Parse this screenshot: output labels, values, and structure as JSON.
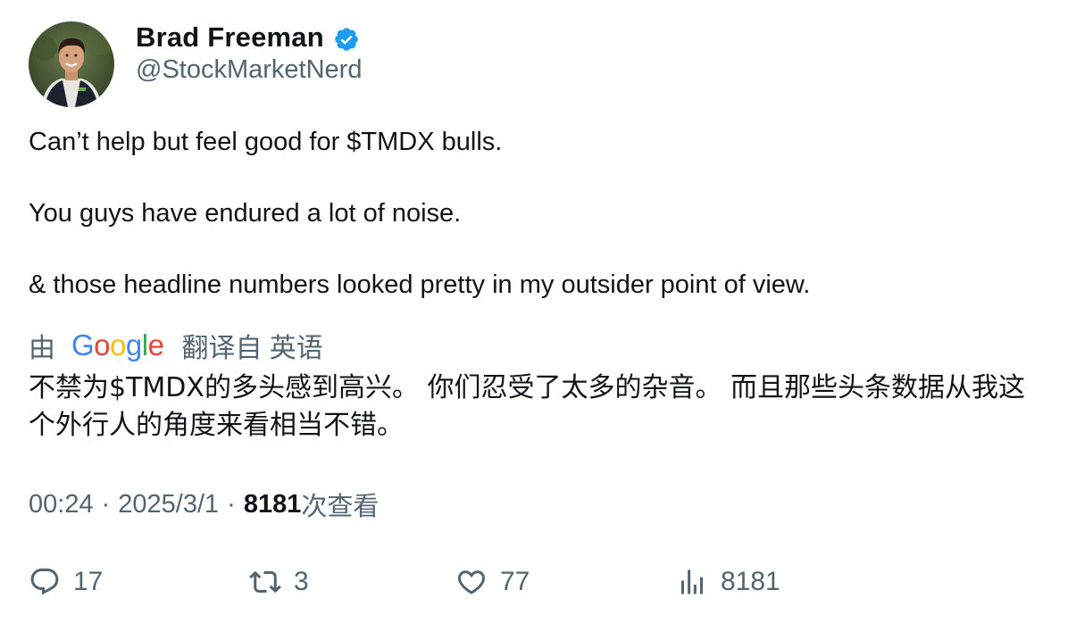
{
  "author": {
    "display_name": "Brad Freeman",
    "handle": "@StockMarketNerd",
    "verified_icon": "verified-badge-icon",
    "verified_color": "#1d9bf0"
  },
  "tweet": {
    "lines": [
      "Can’t help but feel good for $TMDX bulls.",
      "You guys have endured a lot of noise.",
      "& those headline numbers looked pretty in my outsider point of view."
    ]
  },
  "translation": {
    "prefix": "由",
    "provider_letters": [
      {
        "ch": "G",
        "color": "#4285f4"
      },
      {
        "ch": "o",
        "color": "#ea4335"
      },
      {
        "ch": "o",
        "color": "#fbbc05"
      },
      {
        "ch": "g",
        "color": "#4285f4"
      },
      {
        "ch": "l",
        "color": "#34a853"
      },
      {
        "ch": "e",
        "color": "#ea4335"
      }
    ],
    "suffix": "翻译自 英语",
    "text": "不禁为$TMDX的多头感到高兴。 你们忍受了太多的杂音。 而且那些头条数据从我这个外行人的角度来看相当不错。"
  },
  "meta": {
    "time": "00:24",
    "separator": "·",
    "date": "2025/3/1",
    "views_count": "8181",
    "views_label": "次查看"
  },
  "actions": {
    "reply": {
      "icon": "reply-icon",
      "count": "17"
    },
    "retweet": {
      "icon": "retweet-icon",
      "count": "3"
    },
    "like": {
      "icon": "heart-icon",
      "count": "77"
    },
    "views": {
      "icon": "analytics-icon",
      "count": "8181"
    }
  },
  "colors": {
    "text_primary": "#0f1419",
    "text_secondary": "#536471",
    "accent": "#1d9bf0"
  }
}
